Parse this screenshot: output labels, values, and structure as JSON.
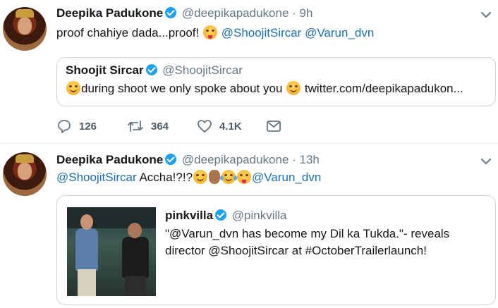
{
  "tweets": [
    {
      "author_name": "Deepika Padukone",
      "handle": "@deepikapadukone",
      "time": "· 9h",
      "text_plain": "proof chahiye dada...proof!",
      "mentions": [
        "@ShoojitSircar",
        "@Varun_dvn"
      ],
      "quoted": {
        "author_name": "Shoojit Sircar",
        "handle": "@ShoojitSircar",
        "text": "during shoot we only spoke about you",
        "link": "twitter.com/deepikapadukon..."
      },
      "actions": {
        "replies": "126",
        "retweets": "364",
        "likes": "4.1K"
      }
    },
    {
      "author_name": "Deepika Padukone",
      "handle": "@deepikapadukone",
      "time": "· 13h",
      "mention_start": "@ShoojitSircar",
      "text_plain": "Accha!?!?",
      "mention_end": "@Varun_dvn",
      "quoted": {
        "author_name": "pinkvilla",
        "handle": "@pinkvilla",
        "line1": "\"@Varun_dvn has become my Dil ka Tukda.\"- reveals",
        "line2": "director @ShoojitSircar at #OctoberTrailerlaunch!"
      }
    }
  ],
  "icons": {
    "reply": "reply-icon",
    "retweet": "retweet-icon",
    "like": "heart-icon",
    "message": "envelope-icon",
    "menu": "chevron-down-icon",
    "verified": "verified-badge-icon"
  },
  "colors": {
    "link": "#1b6fb0",
    "verified": "#1da1f2",
    "muted": "#657786",
    "border": "#ccd6dd"
  }
}
